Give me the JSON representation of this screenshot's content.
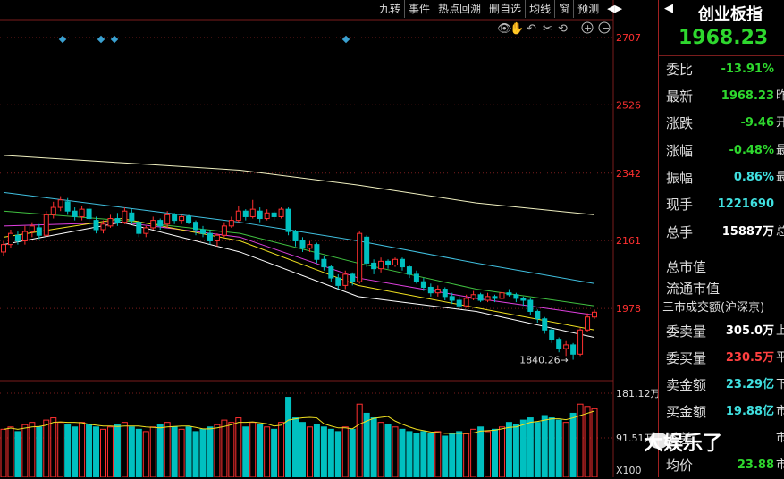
{
  "toolbar": {
    "items": [
      "九转",
      "事件",
      "热点回溯",
      "删自选",
      "均线",
      "窗",
      "预测"
    ],
    "arrow": "◀▶"
  },
  "colors": {
    "up": "#ff3030",
    "down": "#00c0c0",
    "ma1": "#ffffff",
    "ma2": "#f0e020",
    "ma3": "#e040e0",
    "ma4": "#40c040",
    "ma5": "#40c0e0",
    "ma6": "#f0f0c0",
    "axis_text": "#ff3030",
    "grid": "#7a1d1d"
  },
  "chart_data": {
    "type": "candlestick",
    "y_ticks": [
      "2707",
      "2526",
      "2342",
      "2161",
      "1978"
    ],
    "ylim": [
      1798,
      2760
    ],
    "min_annotation": "1840.26",
    "volume_ticks": [
      "181.12万",
      "91.51万"
    ],
    "volume_unit": "X100",
    "candles": [
      {
        "o": 2130,
        "c": 2150,
        "h": 2160,
        "l": 2120
      },
      {
        "o": 2150,
        "c": 2180,
        "h": 2190,
        "l": 2140
      },
      {
        "o": 2175,
        "c": 2160,
        "h": 2185,
        "l": 2150
      },
      {
        "o": 2160,
        "c": 2185,
        "h": 2200,
        "l": 2150
      },
      {
        "o": 2185,
        "c": 2200,
        "h": 2210,
        "l": 2170
      },
      {
        "o": 2195,
        "c": 2175,
        "h": 2205,
        "l": 2165
      },
      {
        "o": 2175,
        "c": 2230,
        "h": 2240,
        "l": 2170
      },
      {
        "o": 2230,
        "c": 2250,
        "h": 2265,
        "l": 2220
      },
      {
        "o": 2250,
        "c": 2270,
        "h": 2280,
        "l": 2240
      },
      {
        "o": 2265,
        "c": 2240,
        "h": 2275,
        "l": 2230
      },
      {
        "o": 2240,
        "c": 2225,
        "h": 2250,
        "l": 2215
      },
      {
        "o": 2225,
        "c": 2245,
        "h": 2255,
        "l": 2215
      },
      {
        "o": 2245,
        "c": 2220,
        "h": 2255,
        "l": 2195
      },
      {
        "o": 2215,
        "c": 2190,
        "h": 2225,
        "l": 2180
      },
      {
        "o": 2190,
        "c": 2205,
        "h": 2215,
        "l": 2180
      },
      {
        "o": 2200,
        "c": 2220,
        "h": 2230,
        "l": 2195
      },
      {
        "o": 2220,
        "c": 2210,
        "h": 2235,
        "l": 2200
      },
      {
        "o": 2210,
        "c": 2240,
        "h": 2250,
        "l": 2205
      },
      {
        "o": 2235,
        "c": 2215,
        "h": 2245,
        "l": 2205
      },
      {
        "o": 2210,
        "c": 2180,
        "h": 2215,
        "l": 2170
      },
      {
        "o": 2180,
        "c": 2195,
        "h": 2200,
        "l": 2170
      },
      {
        "o": 2195,
        "c": 2215,
        "h": 2225,
        "l": 2190
      },
      {
        "o": 2215,
        "c": 2200,
        "h": 2220,
        "l": 2190
      },
      {
        "o": 2205,
        "c": 2230,
        "h": 2240,
        "l": 2195
      },
      {
        "o": 2230,
        "c": 2215,
        "h": 2235,
        "l": 2205
      },
      {
        "o": 2215,
        "c": 2225,
        "h": 2230,
        "l": 2205
      },
      {
        "o": 2225,
        "c": 2210,
        "h": 2230,
        "l": 2205
      },
      {
        "o": 2210,
        "c": 2190,
        "h": 2215,
        "l": 2175
      },
      {
        "o": 2190,
        "c": 2180,
        "h": 2200,
        "l": 2170
      },
      {
        "o": 2180,
        "c": 2160,
        "h": 2190,
        "l": 2150
      },
      {
        "o": 2160,
        "c": 2175,
        "h": 2180,
        "l": 2145
      },
      {
        "o": 2175,
        "c": 2200,
        "h": 2210,
        "l": 2170
      },
      {
        "o": 2200,
        "c": 2215,
        "h": 2225,
        "l": 2195
      },
      {
        "o": 2215,
        "c": 2240,
        "h": 2255,
        "l": 2210
      },
      {
        "o": 2240,
        "c": 2225,
        "h": 2245,
        "l": 2215
      },
      {
        "o": 2225,
        "c": 2245,
        "h": 2270,
        "l": 2220
      },
      {
        "o": 2240,
        "c": 2220,
        "h": 2250,
        "l": 2210
      },
      {
        "o": 2220,
        "c": 2235,
        "h": 2245,
        "l": 2215
      },
      {
        "o": 2235,
        "c": 2225,
        "h": 2240,
        "l": 2215
      },
      {
        "o": 2225,
        "c": 2245,
        "h": 2250,
        "l": 2220
      },
      {
        "o": 2245,
        "c": 2185,
        "h": 2250,
        "l": 2175
      },
      {
        "o": 2185,
        "c": 2160,
        "h": 2190,
        "l": 2145
      },
      {
        "o": 2160,
        "c": 2140,
        "h": 2170,
        "l": 2130
      },
      {
        "o": 2140,
        "c": 2150,
        "h": 2160,
        "l": 2130
      },
      {
        "o": 2150,
        "c": 2110,
        "h": 2155,
        "l": 2100
      },
      {
        "o": 2110,
        "c": 2090,
        "h": 2120,
        "l": 2080
      },
      {
        "o": 2090,
        "c": 2060,
        "h": 2095,
        "l": 2050
      },
      {
        "o": 2060,
        "c": 2040,
        "h": 2070,
        "l": 2030
      },
      {
        "o": 2040,
        "c": 2070,
        "h": 2080,
        "l": 2030
      },
      {
        "o": 2070,
        "c": 2050,
        "h": 2075,
        "l": 2040
      },
      {
        "o": 2050,
        "c": 2180,
        "h": 2185,
        "l": 2045
      },
      {
        "o": 2170,
        "c": 2100,
        "h": 2175,
        "l": 2090
      },
      {
        "o": 2100,
        "c": 2085,
        "h": 2110,
        "l": 2070
      },
      {
        "o": 2085,
        "c": 2105,
        "h": 2115,
        "l": 2075
      },
      {
        "o": 2105,
        "c": 2095,
        "h": 2110,
        "l": 2085
      },
      {
        "o": 2095,
        "c": 2110,
        "h": 2115,
        "l": 2090
      },
      {
        "o": 2110,
        "c": 2090,
        "h": 2115,
        "l": 2080
      },
      {
        "o": 2090,
        "c": 2070,
        "h": 2095,
        "l": 2060
      },
      {
        "o": 2070,
        "c": 2050,
        "h": 2080,
        "l": 2045
      },
      {
        "o": 2050,
        "c": 2035,
        "h": 2060,
        "l": 2025
      },
      {
        "o": 2035,
        "c": 2020,
        "h": 2045,
        "l": 2010
      },
      {
        "o": 2020,
        "c": 2030,
        "h": 2040,
        "l": 2010
      },
      {
        "o": 2030,
        "c": 2010,
        "h": 2035,
        "l": 2000
      },
      {
        "o": 2010,
        "c": 2000,
        "h": 2020,
        "l": 1990
      },
      {
        "o": 2000,
        "c": 1985,
        "h": 2010,
        "l": 1975
      },
      {
        "o": 1985,
        "c": 2005,
        "h": 2015,
        "l": 1980
      },
      {
        "o": 2005,
        "c": 2015,
        "h": 2025,
        "l": 2000
      },
      {
        "o": 2015,
        "c": 2000,
        "h": 2020,
        "l": 1995
      },
      {
        "o": 2000,
        "c": 2010,
        "h": 2020,
        "l": 1995
      },
      {
        "o": 2010,
        "c": 2005,
        "h": 2015,
        "l": 1995
      },
      {
        "o": 2005,
        "c": 2020,
        "h": 2025,
        "l": 2000
      },
      {
        "o": 2020,
        "c": 2015,
        "h": 2030,
        "l": 2010
      },
      {
        "o": 2015,
        "c": 2005,
        "h": 2020,
        "l": 1995
      },
      {
        "o": 2005,
        "c": 2000,
        "h": 2010,
        "l": 1985
      },
      {
        "o": 2000,
        "c": 1970,
        "h": 2005,
        "l": 1960
      },
      {
        "o": 1970,
        "c": 1950,
        "h": 1975,
        "l": 1940
      },
      {
        "o": 1950,
        "c": 1920,
        "h": 1955,
        "l": 1910
      },
      {
        "o": 1920,
        "c": 1895,
        "h": 1925,
        "l": 1885
      },
      {
        "o": 1895,
        "c": 1870,
        "h": 1900,
        "l": 1860
      },
      {
        "o": 1870,
        "c": 1880,
        "h": 1890,
        "l": 1850
      },
      {
        "o": 1880,
        "c": 1855,
        "h": 1885,
        "l": 1840
      },
      {
        "o": 1855,
        "c": 1920,
        "h": 1925,
        "l": 1850
      },
      {
        "o": 1920,
        "c": 1955,
        "h": 1965,
        "l": 1915
      },
      {
        "o": 1955,
        "c": 1968,
        "h": 1975,
        "l": 1950
      }
    ],
    "volumes": [
      1.05,
      1.1,
      1.0,
      1.15,
      1.2,
      1.1,
      1.25,
      1.3,
      1.2,
      1.15,
      1.1,
      1.2,
      1.15,
      1.1,
      1.05,
      1.1,
      1.15,
      1.2,
      1.1,
      1.05,
      1.0,
      1.1,
      1.15,
      1.2,
      1.1,
      1.05,
      1.1,
      1.0,
      1.05,
      1.1,
      1.15,
      1.25,
      1.2,
      1.3,
      1.1,
      1.2,
      1.15,
      1.1,
      1.05,
      1.2,
      1.75,
      1.3,
      1.2,
      1.1,
      1.15,
      1.1,
      1.05,
      1.0,
      1.1,
      1.05,
      1.6,
      1.4,
      1.3,
      1.2,
      1.15,
      1.1,
      1.05,
      1.0,
      0.95,
      1.0,
      0.95,
      1.0,
      0.9,
      0.95,
      1.0,
      0.95,
      1.05,
      1.1,
      1.0,
      1.05,
      1.1,
      1.2,
      1.15,
      1.25,
      1.3,
      1.2,
      1.35,
      1.3,
      1.25,
      1.2,
      1.4,
      1.6,
      1.55,
      1.5
    ],
    "ma_lines": [
      {
        "key": "ma6",
        "values": [
          2390,
          2370,
          2350,
          2310,
          2262,
          2230
        ]
      },
      {
        "key": "ma5",
        "values": [
          2290,
          2250,
          2210,
          2160,
          2100,
          2045
        ]
      },
      {
        "key": "ma4",
        "values": [
          2240,
          2215,
          2180,
          2100,
          2030,
          1985
        ]
      },
      {
        "key": "ma3",
        "values": [
          2200,
          2210,
          2170,
          2060,
          2005,
          1960
        ]
      },
      {
        "key": "ma2",
        "values": [
          2170,
          2220,
          2160,
          2040,
          1980,
          1920
        ]
      },
      {
        "key": "ma1",
        "values": [
          2150,
          2210,
          2130,
          2010,
          1970,
          1900
        ]
      }
    ],
    "events": [
      70,
      113,
      128,
      387
    ]
  },
  "panel": {
    "title": "创业板指",
    "price": "1968.23",
    "rows": [
      {
        "label": "委比",
        "value": "-13.91%",
        "color": "green",
        "trail": ""
      },
      {
        "label": "最新",
        "value": "1968.23",
        "color": "green",
        "trail": "昨"
      },
      {
        "label": "涨跌",
        "value": "-9.46",
        "color": "green",
        "trail": "开"
      },
      {
        "label": "涨幅",
        "value": "-0.48%",
        "color": "green",
        "trail": "最"
      },
      {
        "label": "振幅",
        "value": "0.86%",
        "color": "cyan",
        "trail": "最"
      },
      {
        "label": "现手",
        "value": "1221690",
        "color": "cyan",
        "trail": ""
      },
      {
        "label": "总手",
        "value": "15887万",
        "color": "white",
        "trail": "总"
      },
      {
        "label": "总市值",
        "value": "",
        "color": "white",
        "trail": ""
      },
      {
        "label": "流通市值",
        "value": "",
        "color": "white",
        "trail": ""
      },
      {
        "label": "三市成交额(沪深京)",
        "value": "",
        "color": "white",
        "trail": ""
      },
      {
        "label": "委卖量",
        "value": "305.0万",
        "color": "white",
        "trail": "上"
      },
      {
        "label": "委买量",
        "value": "230.5万",
        "color": "red",
        "trail": "平"
      },
      {
        "label": "卖金额",
        "value": "23.29亿",
        "color": "cyan",
        "trail": "下"
      },
      {
        "label": "买金额",
        "value": "19.88亿",
        "color": "cyan",
        "trail": "市"
      },
      {
        "label": "委差",
        "value": "",
        "color": "white",
        "trail": "市"
      },
      {
        "label": "均价",
        "value": "23.88",
        "color": "green",
        "trail": "市"
      }
    ]
  },
  "watermark": "大娱乐了"
}
